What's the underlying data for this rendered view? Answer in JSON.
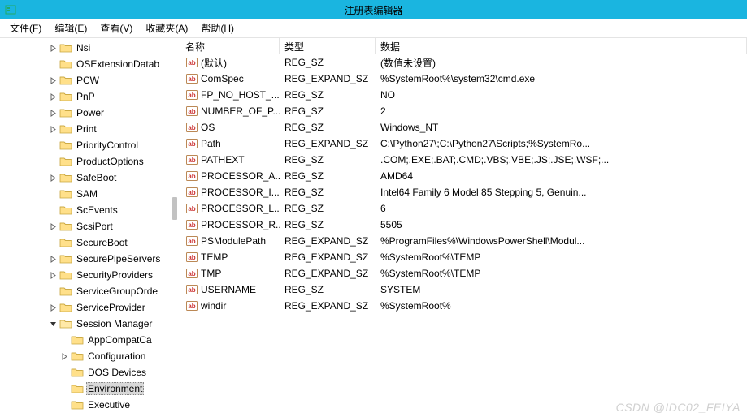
{
  "window": {
    "title": "注册表编辑器"
  },
  "menu": {
    "file": "文件(F)",
    "edit": "编辑(E)",
    "view": "查看(V)",
    "favorites": "收藏夹(A)",
    "help": "帮助(H)"
  },
  "tree": [
    {
      "indent": 4,
      "expander": "right",
      "label": "Nsi"
    },
    {
      "indent": 4,
      "expander": "none",
      "label": "OSExtensionDatab"
    },
    {
      "indent": 4,
      "expander": "right",
      "label": "PCW"
    },
    {
      "indent": 4,
      "expander": "right",
      "label": "PnP"
    },
    {
      "indent": 4,
      "expander": "right",
      "label": "Power"
    },
    {
      "indent": 4,
      "expander": "right",
      "label": "Print"
    },
    {
      "indent": 4,
      "expander": "none",
      "label": "PriorityControl"
    },
    {
      "indent": 4,
      "expander": "none",
      "label": "ProductOptions"
    },
    {
      "indent": 4,
      "expander": "right",
      "label": "SafeBoot"
    },
    {
      "indent": 4,
      "expander": "none",
      "label": "SAM"
    },
    {
      "indent": 4,
      "expander": "none",
      "label": "ScEvents"
    },
    {
      "indent": 4,
      "expander": "right",
      "label": "ScsiPort"
    },
    {
      "indent": 4,
      "expander": "none",
      "label": "SecureBoot"
    },
    {
      "indent": 4,
      "expander": "right",
      "label": "SecurePipeServers"
    },
    {
      "indent": 4,
      "expander": "right",
      "label": "SecurityProviders"
    },
    {
      "indent": 4,
      "expander": "none",
      "label": "ServiceGroupOrde"
    },
    {
      "indent": 4,
      "expander": "right",
      "label": "ServiceProvider"
    },
    {
      "indent": 4,
      "expander": "down",
      "label": "Session Manager"
    },
    {
      "indent": 5,
      "expander": "none",
      "label": "AppCompatCa"
    },
    {
      "indent": 5,
      "expander": "right",
      "label": "Configuration"
    },
    {
      "indent": 5,
      "expander": "none",
      "label": "DOS Devices"
    },
    {
      "indent": 5,
      "expander": "none",
      "label": "Environment",
      "selected": true
    },
    {
      "indent": 5,
      "expander": "none",
      "label": "Executive"
    }
  ],
  "columns": {
    "name": "名称",
    "type": "类型",
    "data": "数据"
  },
  "values": [
    {
      "name": "(默认)",
      "type": "REG_SZ",
      "data": "(数值未设置)"
    },
    {
      "name": "ComSpec",
      "type": "REG_EXPAND_SZ",
      "data": "%SystemRoot%\\system32\\cmd.exe"
    },
    {
      "name": "FP_NO_HOST_...",
      "type": "REG_SZ",
      "data": "NO"
    },
    {
      "name": "NUMBER_OF_P...",
      "type": "REG_SZ",
      "data": "2"
    },
    {
      "name": "OS",
      "type": "REG_SZ",
      "data": "Windows_NT"
    },
    {
      "name": "Path",
      "type": "REG_EXPAND_SZ",
      "data": "C:\\Python27\\;C:\\Python27\\Scripts;%SystemRo..."
    },
    {
      "name": "PATHEXT",
      "type": "REG_SZ",
      "data": ".COM;.EXE;.BAT;.CMD;.VBS;.VBE;.JS;.JSE;.WSF;..."
    },
    {
      "name": "PROCESSOR_A...",
      "type": "REG_SZ",
      "data": "AMD64"
    },
    {
      "name": "PROCESSOR_I...",
      "type": "REG_SZ",
      "data": "Intel64 Family 6 Model 85 Stepping 5, Genuin..."
    },
    {
      "name": "PROCESSOR_L...",
      "type": "REG_SZ",
      "data": "6"
    },
    {
      "name": "PROCESSOR_R...",
      "type": "REG_SZ",
      "data": "5505"
    },
    {
      "name": "PSModulePath",
      "type": "REG_EXPAND_SZ",
      "data": "%ProgramFiles%\\WindowsPowerShell\\Modul..."
    },
    {
      "name": "TEMP",
      "type": "REG_EXPAND_SZ",
      "data": "%SystemRoot%\\TEMP"
    },
    {
      "name": "TMP",
      "type": "REG_EXPAND_SZ",
      "data": "%SystemRoot%\\TEMP"
    },
    {
      "name": "USERNAME",
      "type": "REG_SZ",
      "data": "SYSTEM"
    },
    {
      "name": "windir",
      "type": "REG_EXPAND_SZ",
      "data": "%SystemRoot%"
    }
  ],
  "watermark": "CSDN @IDC02_FEIYA"
}
